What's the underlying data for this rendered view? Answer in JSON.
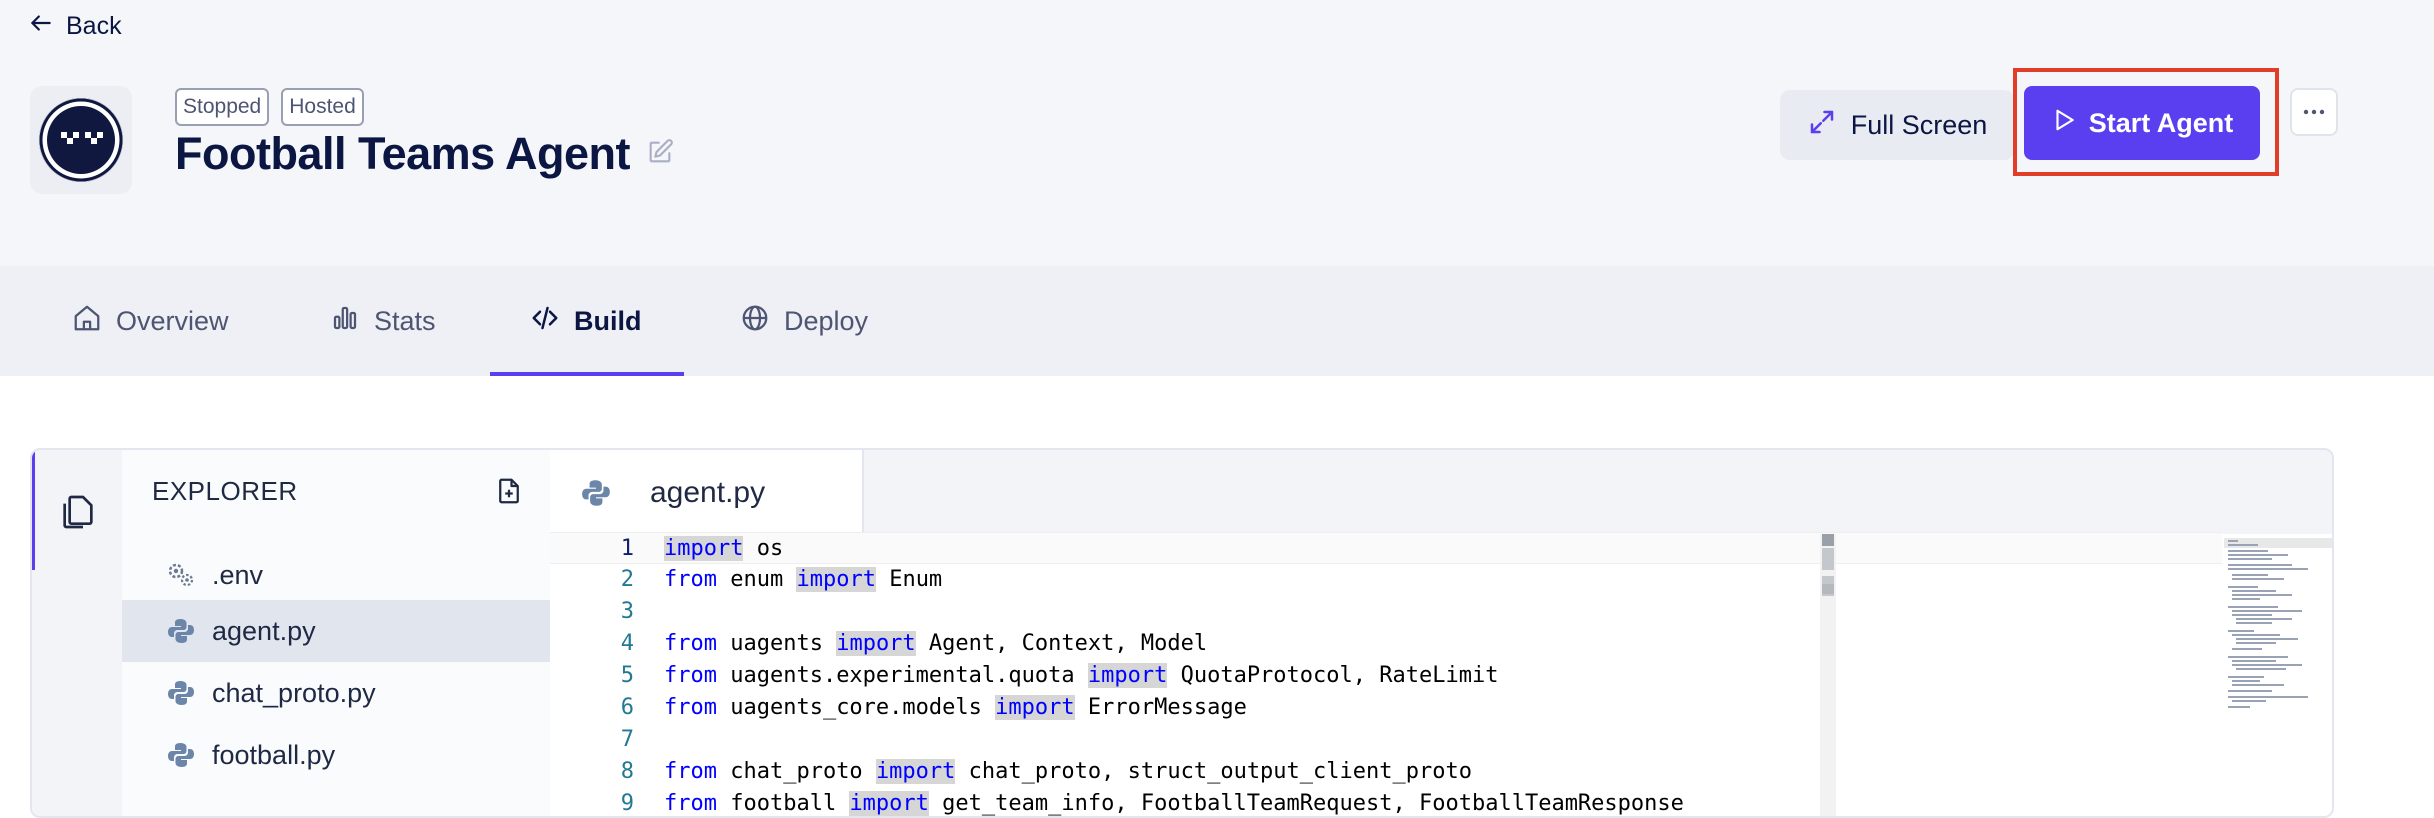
{
  "nav": {
    "back_label": "Back"
  },
  "agent": {
    "status_badges": [
      "Stopped",
      "Hosted"
    ],
    "title": "Football Teams Agent"
  },
  "actions": {
    "fullscreen_label": "Full Screen",
    "start_label": "Start Agent"
  },
  "tabs": [
    {
      "label": "Overview",
      "icon": "home-icon"
    },
    {
      "label": "Stats",
      "icon": "bar-chart-icon"
    },
    {
      "label": "Build",
      "icon": "code-icon",
      "active": true
    },
    {
      "label": "Deploy",
      "icon": "globe-icon"
    }
  ],
  "explorer": {
    "title": "EXPLORER",
    "files": [
      {
        "name": ".env",
        "icon": "gears-icon"
      },
      {
        "name": "agent.py",
        "icon": "python-icon",
        "selected": true
      },
      {
        "name": "chat_proto.py",
        "icon": "python-icon"
      },
      {
        "name": "football.py",
        "icon": "python-icon"
      }
    ]
  },
  "editor": {
    "active_tab": "agent.py",
    "lines": [
      {
        "n": "1",
        "tokens": [
          [
            "import",
            "kw hl"
          ],
          [
            " os",
            ""
          ]
        ]
      },
      {
        "n": "2",
        "tokens": [
          [
            "from",
            "kw"
          ],
          [
            " enum ",
            ""
          ],
          [
            "import",
            "kw hl"
          ],
          [
            " Enum",
            ""
          ]
        ]
      },
      {
        "n": "3",
        "tokens": []
      },
      {
        "n": "4",
        "tokens": [
          [
            "from",
            "kw"
          ],
          [
            " uagents ",
            ""
          ],
          [
            "import",
            "kw hl"
          ],
          [
            " Agent, Context, Model",
            ""
          ]
        ]
      },
      {
        "n": "5",
        "tokens": [
          [
            "from",
            "kw"
          ],
          [
            " uagents.experimental.quota ",
            ""
          ],
          [
            "import",
            "kw hl"
          ],
          [
            " QuotaProtocol, RateLimit",
            ""
          ]
        ]
      },
      {
        "n": "6",
        "tokens": [
          [
            "from",
            "kw"
          ],
          [
            " uagents_core.models ",
            ""
          ],
          [
            "import",
            "kw hl"
          ],
          [
            " ErrorMessage",
            ""
          ]
        ]
      },
      {
        "n": "7",
        "tokens": []
      },
      {
        "n": "8",
        "tokens": [
          [
            "from",
            "kw"
          ],
          [
            " chat_proto ",
            ""
          ],
          [
            "import",
            "kw hl"
          ],
          [
            " chat_proto, struct_output_client_proto",
            ""
          ]
        ]
      },
      {
        "n": "9",
        "tokens": [
          [
            "from",
            "kw"
          ],
          [
            " football ",
            ""
          ],
          [
            "import",
            "kw hl"
          ],
          [
            " get_team_info, FootballTeamRequest, FootballTeamResponse",
            ""
          ]
        ]
      }
    ]
  },
  "colors": {
    "accent": "#5a3ff0",
    "highlight_border": "#e23d28",
    "keyword": "#0000ff",
    "line_number": "#237893"
  }
}
